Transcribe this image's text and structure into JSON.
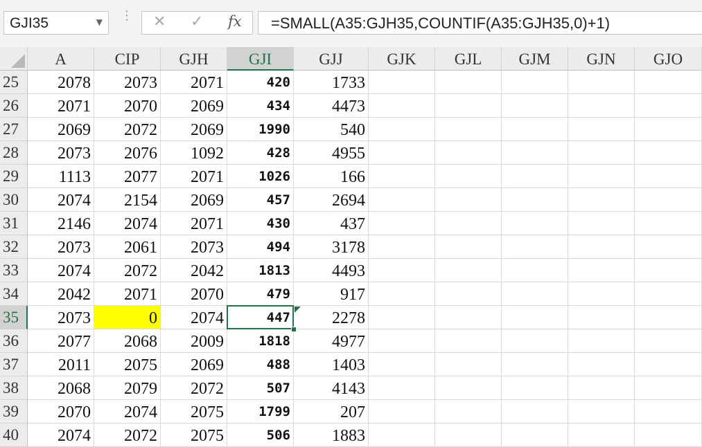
{
  "name_box": {
    "value": "GJI35",
    "dropdown_icon": "chevron-down-icon"
  },
  "formula_bar": {
    "cancel_icon": "close-icon",
    "enter_icon": "check-icon",
    "fx_label": "fx",
    "formula": "=SMALL(A35:GJH35,COUNTIF(A35:GJH35,0)+1)"
  },
  "columns": [
    "A",
    "CIP",
    "GJH",
    "GJI",
    "GJJ",
    "GJK",
    "GJL",
    "GJM",
    "GJN",
    "GJO"
  ],
  "selected_column": "GJI",
  "selected_row": "35",
  "highlight_color": "#ffff00",
  "accent_color": "#217346",
  "rows": [
    {
      "num": "25",
      "A": "2078",
      "CIP": "2073",
      "GJH": "2071",
      "GJI": "420",
      "GJJ": "1733"
    },
    {
      "num": "26",
      "A": "2071",
      "CIP": "2070",
      "GJH": "2069",
      "GJI": "434",
      "GJJ": "4473"
    },
    {
      "num": "27",
      "A": "2069",
      "CIP": "2072",
      "GJH": "2069",
      "GJI": "1990",
      "GJJ": "540"
    },
    {
      "num": "28",
      "A": "2073",
      "CIP": "2076",
      "GJH": "1092",
      "GJI": "428",
      "GJJ": "4955"
    },
    {
      "num": "29",
      "A": "1113",
      "CIP": "2077",
      "GJH": "2071",
      "GJI": "1026",
      "GJJ": "166"
    },
    {
      "num": "30",
      "A": "2074",
      "CIP": "2154",
      "GJH": "2069",
      "GJI": "457",
      "GJJ": "2694"
    },
    {
      "num": "31",
      "A": "2146",
      "CIP": "2074",
      "GJH": "2071",
      "GJI": "430",
      "GJJ": "437"
    },
    {
      "num": "32",
      "A": "2073",
      "CIP": "2061",
      "GJH": "2073",
      "GJI": "494",
      "GJJ": "3178"
    },
    {
      "num": "33",
      "A": "2074",
      "CIP": "2072",
      "GJH": "2042",
      "GJI": "1813",
      "GJJ": "4493"
    },
    {
      "num": "34",
      "A": "2042",
      "CIP": "2071",
      "GJH": "2070",
      "GJI": "479",
      "GJJ": "917"
    },
    {
      "num": "35",
      "A": "2073",
      "CIP": "0",
      "GJH": "2074",
      "GJI": "447",
      "GJJ": "2278"
    },
    {
      "num": "36",
      "A": "2077",
      "CIP": "2068",
      "GJH": "2009",
      "GJI": "1818",
      "GJJ": "4977"
    },
    {
      "num": "37",
      "A": "2011",
      "CIP": "2075",
      "GJH": "2069",
      "GJI": "488",
      "GJJ": "1403"
    },
    {
      "num": "38",
      "A": "2068",
      "CIP": "2079",
      "GJH": "2072",
      "GJI": "507",
      "GJJ": "4143"
    },
    {
      "num": "39",
      "A": "2070",
      "CIP": "2074",
      "GJH": "2075",
      "GJI": "1799",
      "GJJ": "207"
    },
    {
      "num": "40",
      "A": "2074",
      "CIP": "2072",
      "GJH": "2075",
      "GJI": "506",
      "GJJ": "1883"
    }
  ]
}
